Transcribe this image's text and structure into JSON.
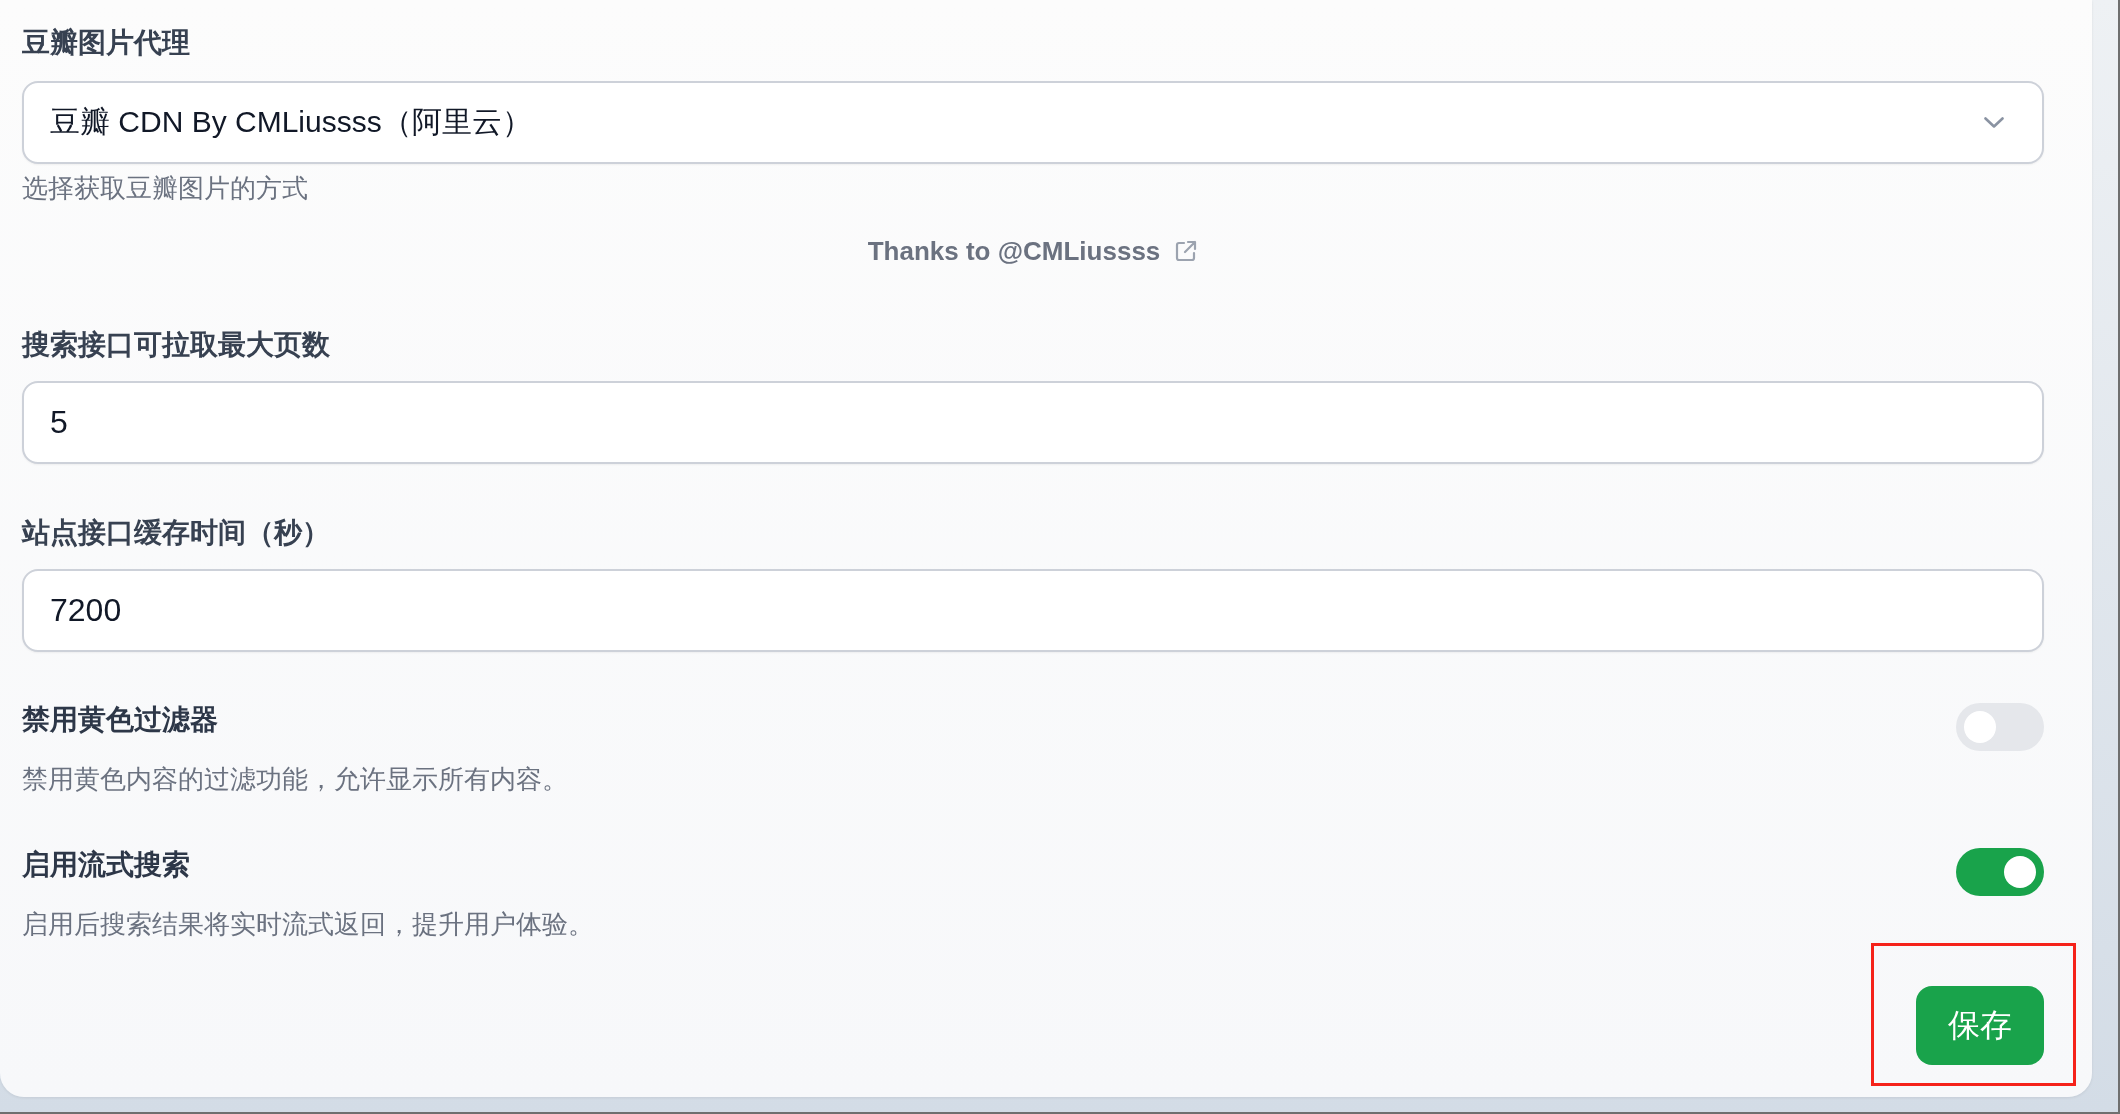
{
  "image_proxy": {
    "label": "豆瓣图片代理",
    "value": "豆瓣 CDN By CMLiussss（阿里云）",
    "description": "选择获取豆瓣图片的方式"
  },
  "credit_link": {
    "text": "Thanks to @CMLiussss"
  },
  "fields": [
    {
      "label": "搜索接口可拉取最大页数",
      "value": "5"
    },
    {
      "label": "站点接口缓存时间（秒）",
      "value": "7200"
    }
  ],
  "switches": [
    {
      "label": "禁用黄色过滤器",
      "description": "禁用黄色内容的过滤功能，允许显示所有内容。",
      "on": false
    },
    {
      "label": "启用流式搜索",
      "description": "启用后搜索结果将实时流式返回，提升用户体验。",
      "on": true
    }
  ],
  "save_button": {
    "label": "保存",
    "highlighted": true
  }
}
